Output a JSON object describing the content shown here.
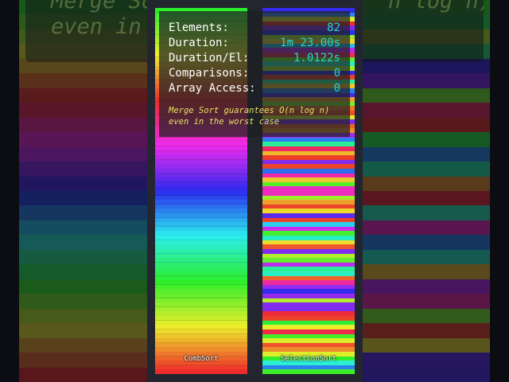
{
  "stats": [
    {
      "label": "Elements:",
      "value": "82"
    },
    {
      "label": "Duration:",
      "value": "1m 23.00s"
    },
    {
      "label": "Duration/El:",
      "value": "1.0122s"
    },
    {
      "label": "Comparisons:",
      "value": "0"
    },
    {
      "label": "Array Access:",
      "value": "0"
    }
  ],
  "note": {
    "line1": "Merge Sort guarantees O(n log n)",
    "line2": "even in the worst case"
  },
  "background_caption": {
    "line1": "Merge So",
    "line1_right": "n log n)",
    "line2": "even in"
  },
  "panels": {
    "left_label": "CombSort",
    "right_label": "SelectionSort"
  },
  "colors": {
    "stat_value": "#22d8d0",
    "note_text": "#e8e060",
    "panel_frame": "#23262f"
  }
}
